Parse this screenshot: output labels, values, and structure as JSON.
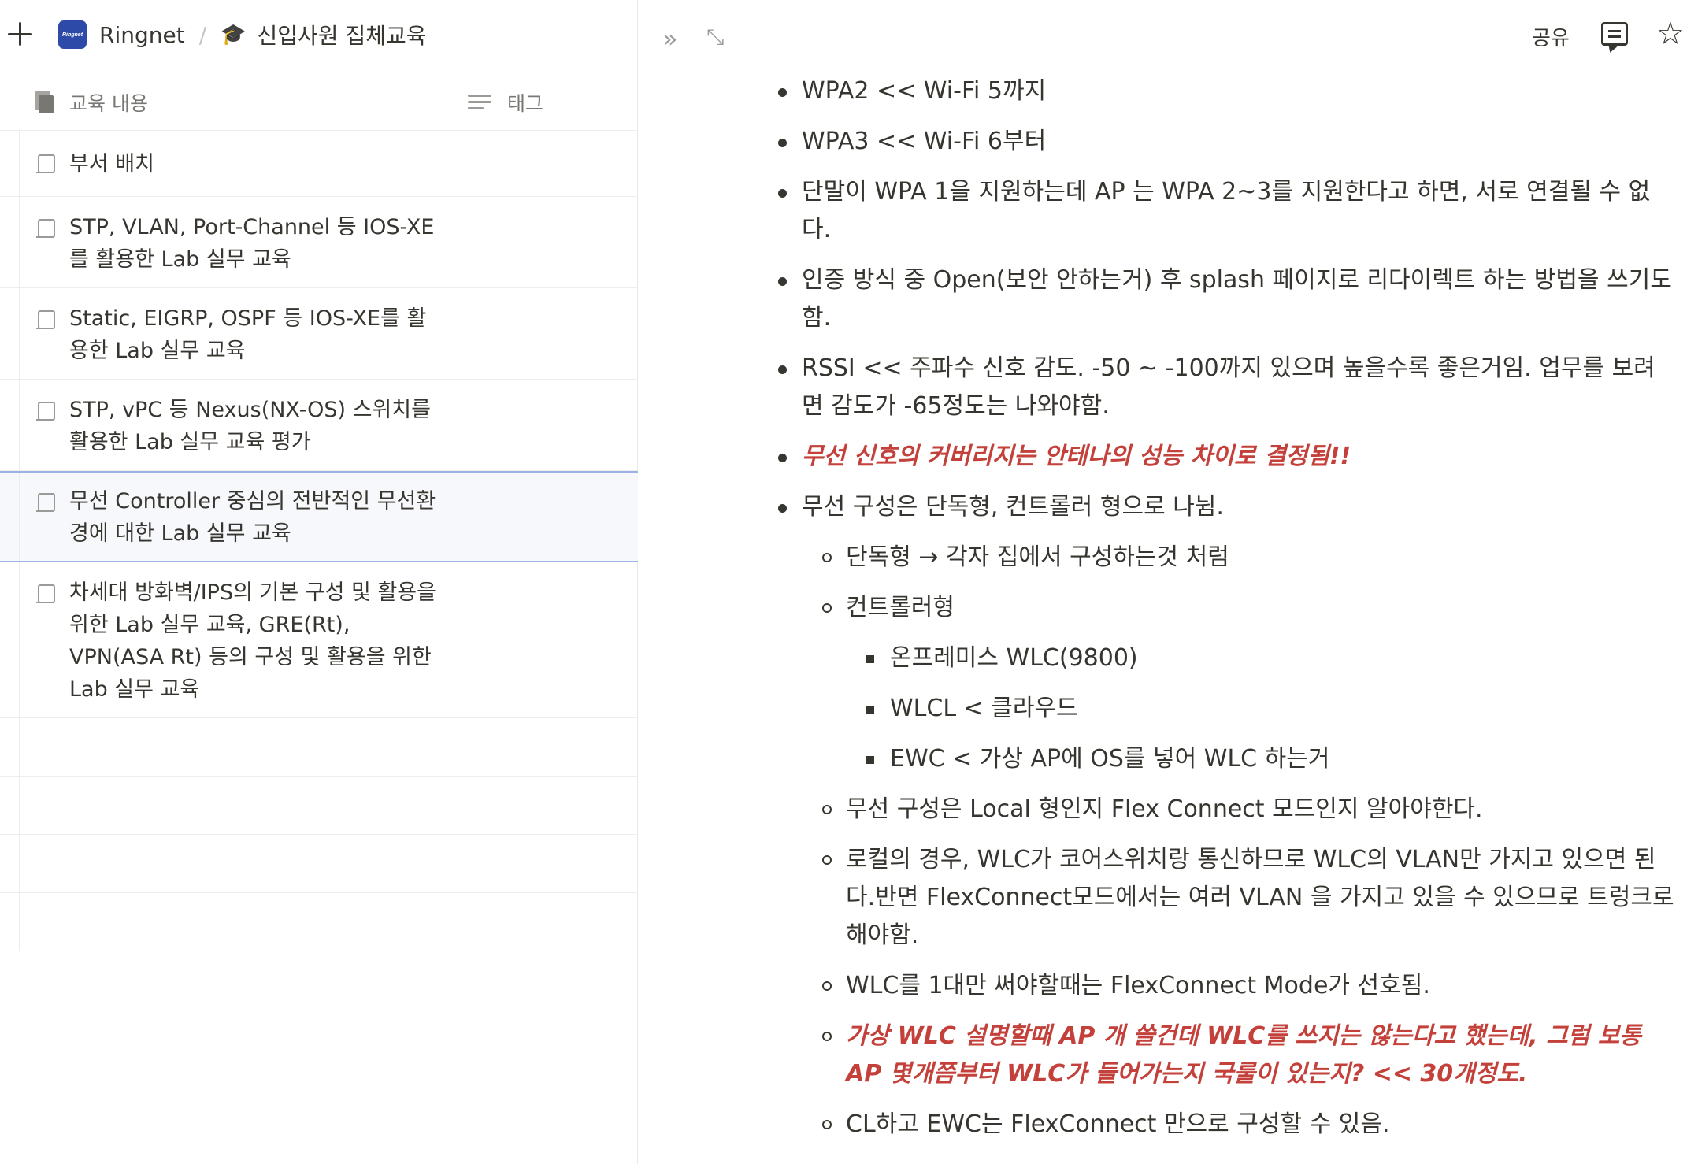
{
  "breadcrumb": {
    "workspace": "Ringnet",
    "logo_text": "Ringnet",
    "separator": "/",
    "page_icon": "🎓",
    "page": "신입사원 집체교육"
  },
  "table": {
    "columns": [
      {
        "label": "교육 내용",
        "icon": "book-icon"
      },
      {
        "label": "태그",
        "icon": "lines-icon"
      }
    ],
    "rows": [
      {
        "title": "부서 배치"
      },
      {
        "title": "STP, VLAN, Port-Channel 등 IOS-XE를 활용한 Lab 실무 교육"
      },
      {
        "title": "Static, EIGRP, OSPF 등 IOS-XE를 활용한 Lab 실무 교육"
      },
      {
        "title": "STP, vPC 등 Nexus(NX-OS) 스위치를 활용한 Lab 실무 교육 평가"
      },
      {
        "title": "무선 Controller 중심의 전반적인 무선환경에 대한 Lab 실무 교육"
      },
      {
        "title": "차세대 방화벽/IPS의 기본 구성 및 활용을 위한 Lab 실무 교육, GRE(Rt), VPN(ASA Rt) 등의 구성 및 활용을 위한 Lab 실무 교육"
      }
    ]
  },
  "toolbar": {
    "collapse_icon": "»",
    "expand_icon": "⤡",
    "share_label": "공유",
    "star_icon": "☆"
  },
  "notes": {
    "items": [
      {
        "level": 1,
        "text": "WPA2 << Wi-Fi 5까지"
      },
      {
        "level": 1,
        "text": "WPA3 << Wi-Fi 6부터"
      },
      {
        "level": 1,
        "text": "단말이 WPA 1을 지원하는데 AP 는 WPA 2~3를 지원한다고 하면, 서로 연결될 수 없다."
      },
      {
        "level": 1,
        "text": "인증 방식 중 Open(보안 안하는거) 후 splash 페이지로 리다이렉트 하는 방법을 쓰기도 함."
      },
      {
        "level": 1,
        "text": "RSSI << 주파수 신호 감도. -50 ~ -100까지 있으며 높을수록 좋은거임. 업무를 보려면 감도가 -65정도는 나와야함."
      },
      {
        "level": 1,
        "text": "무선 신호의 커버리지는 안테나의 성능 차이로 결정됨!!",
        "style": "red"
      },
      {
        "level": 1,
        "text": "무선 구성은 단독형, 컨트롤러 형으로 나뉨."
      },
      {
        "level": 2,
        "text": "단독형 → 각자 집에서 구성하는것 처럼"
      },
      {
        "level": 2,
        "text": "컨트롤러형"
      },
      {
        "level": 3,
        "text": "온프레미스 WLC(9800)"
      },
      {
        "level": 3,
        "text": "WLCL < 클라우드"
      },
      {
        "level": 3,
        "text": "EWC < 가상 AP에 OS를 넣어 WLC 하는거"
      },
      {
        "level": 2,
        "text": "무선 구성은 Local 형인지 Flex Connect 모드인지 알아야한다."
      },
      {
        "level": 2,
        "text": "로컬의 경우, WLC가 코어스위치랑 통신하므로 WLC의 VLAN만 가지고 있으면 된다.반면 FlexConnect모드에서는 여러 VLAN 을 가지고 있을 수 있으므로 트렁크로 해야함."
      },
      {
        "level": 2,
        "text": "WLC를 1대만 써야할때는 FlexConnect Mode가 선호됨."
      },
      {
        "level": 2,
        "text": "가상 WLC 설명할때 AP 개 쓸건데 WLC를 쓰지는 않는다고 했는데, 그럼 보통 AP 몇개쯤부터 WLC가 들어가는지 국룰이 있는지? << 30개정도.",
        "style": "red"
      },
      {
        "level": 2,
        "text": "CL하고 EWC는 FlexConnect 만으로 구성할 수 있음."
      }
    ]
  },
  "colors": {
    "accent_red": "#c4403a",
    "selection_border": "#9db3e8",
    "logo_bg": "#2e4aa8"
  }
}
